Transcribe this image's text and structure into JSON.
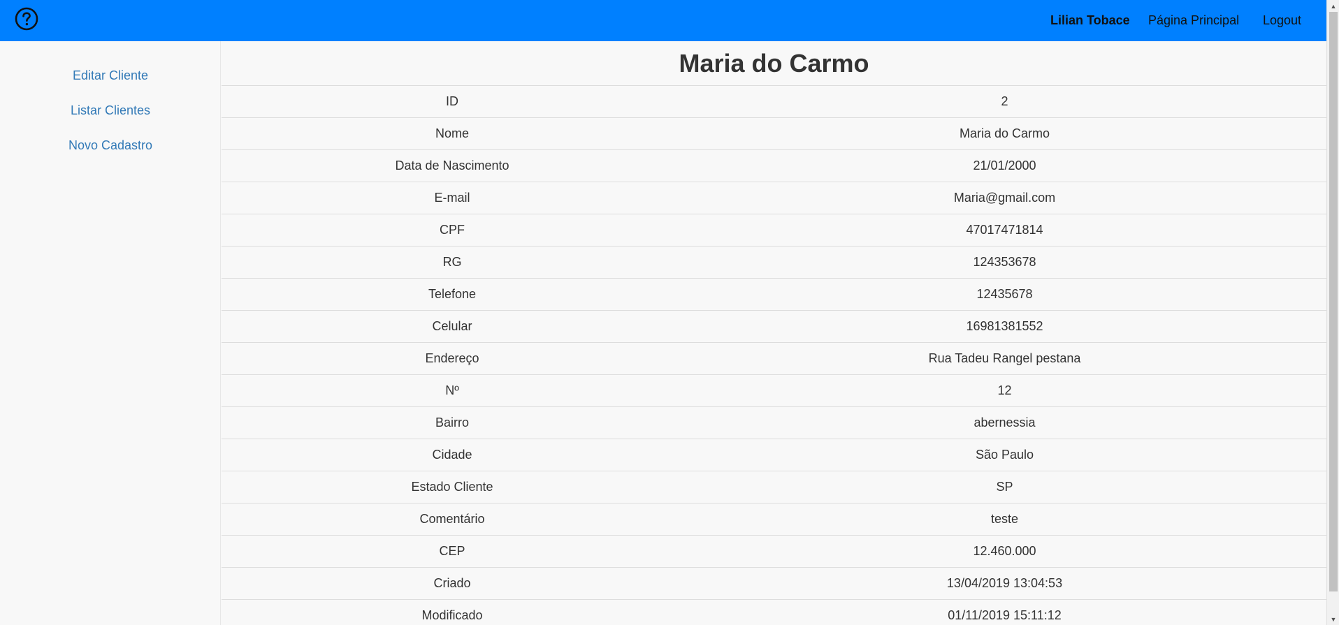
{
  "header": {
    "help_icon": "help-circle-icon",
    "user_name": "Lilian Tobace",
    "home_label": "Página Principal",
    "logout_label": "Logout",
    "bg_color": "#0080ff"
  },
  "sidebar": {
    "items": [
      {
        "label": "Editar Cliente"
      },
      {
        "label": "Listar Clientes"
      },
      {
        "label": "Novo Cadastro"
      }
    ]
  },
  "main": {
    "title": "Maria do Carmo",
    "rows": [
      {
        "label": "ID",
        "value": "2"
      },
      {
        "label": "Nome",
        "value": "Maria do Carmo"
      },
      {
        "label": "Data de Nascimento",
        "value": "21/01/2000"
      },
      {
        "label": "E-mail",
        "value": "Maria@gmail.com"
      },
      {
        "label": "CPF",
        "value": "47017471814"
      },
      {
        "label": "RG",
        "value": "124353678"
      },
      {
        "label": "Telefone",
        "value": "12435678"
      },
      {
        "label": "Celular",
        "value": "16981381552"
      },
      {
        "label": "Endereço",
        "value": "Rua Tadeu Rangel pestana"
      },
      {
        "label": "Nº",
        "value": "12"
      },
      {
        "label": "Bairro",
        "value": "abernessia"
      },
      {
        "label": "Cidade",
        "value": "São Paulo"
      },
      {
        "label": "Estado Cliente",
        "value": "SP"
      },
      {
        "label": "Comentário",
        "value": "teste"
      },
      {
        "label": "CEP",
        "value": "12.460.000"
      },
      {
        "label": "Criado",
        "value": "13/04/2019 13:04:53"
      },
      {
        "label": "Modificado",
        "value": "01/11/2019 15:11:12"
      }
    ]
  },
  "scrollbar": {
    "up_icon": "scroll-up-arrow-icon",
    "down_icon": "scroll-down-arrow-icon"
  }
}
